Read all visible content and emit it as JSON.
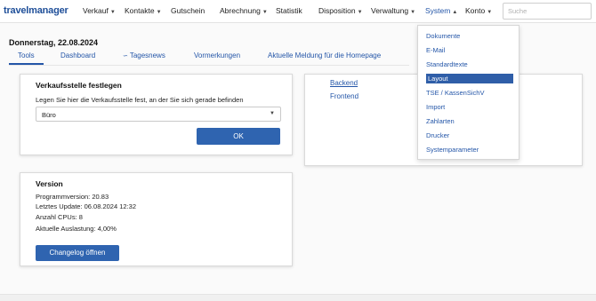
{
  "app": {
    "logo": "travelmanager"
  },
  "nav": {
    "items": [
      {
        "label": "Verkauf",
        "chevron": "down"
      },
      {
        "label": "Kontakte",
        "chevron": "down"
      },
      {
        "label": "Gutschein",
        "chevron": ""
      },
      {
        "label": "Abrechnung",
        "chevron": "down"
      },
      {
        "label": "Statistik",
        "chevron": ""
      },
      {
        "label": "Disposition",
        "chevron": "down"
      },
      {
        "label": "Verwaltung",
        "chevron": "down"
      },
      {
        "label": "System",
        "chevron": "up"
      },
      {
        "label": "Konto",
        "chevron": "down"
      }
    ],
    "search_placeholder": "Suche"
  },
  "page": {
    "date": "Donnerstag, 22.08.2024"
  },
  "tabs": [
    {
      "label": "Tools"
    },
    {
      "label": "Dashboard"
    },
    {
      "label": "Tagesnews"
    },
    {
      "label": "Vormerkungen"
    },
    {
      "label": "Aktuelle Meldung für die Homepage"
    }
  ],
  "verkaufsstelle": {
    "title": "Verkaufsstelle festlegen",
    "description": "Legen Sie hier die Verkaufsstelle fest, an der Sie sich gerade befinden",
    "selected": "Büro",
    "ok_label": "OK"
  },
  "links_card": {
    "items": [
      "Backend",
      "Frontend"
    ]
  },
  "version": {
    "title": "Version",
    "lines": [
      "Programmversion: 20.83",
      "Letztes Update: 06.08.2024 12:32",
      "Anzahl CPUs: 8",
      "Aktuelle Auslastung: 4,00%"
    ],
    "changelog_label": "Changelog öffnen"
  },
  "system_menu": {
    "items": [
      "Dokumente",
      "E-Mail",
      "Standardtexte",
      "Layout",
      "TSE / KassenSichV",
      "Import",
      "Zahlarten",
      "Drucker",
      "Systemparameter"
    ],
    "highlighted": "Layout"
  },
  "colors": {
    "accent": "#2f64b0",
    "link": "#2456a8"
  }
}
